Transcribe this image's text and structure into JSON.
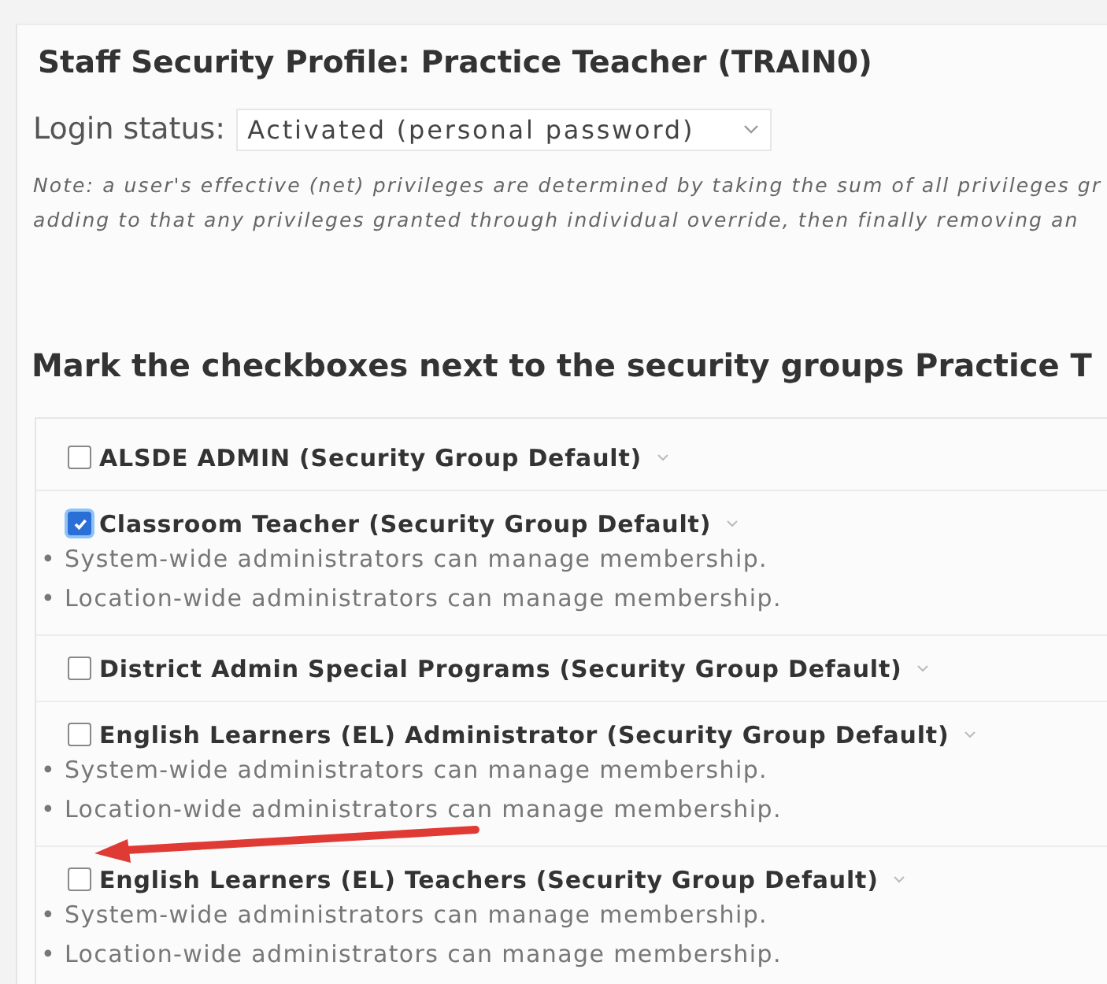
{
  "title": "Staff Security Profile: Practice Teacher (TRAIN0)",
  "login_status": {
    "label": "Login status:",
    "value": "Activated (personal password)"
  },
  "note": [
    "Note: a user's effective (net) privileges are determined by taking the sum of all privileges gr",
    "adding to that any privileges granted through individual override, then finally removing an"
  ],
  "groups_heading": "Mark the checkboxes next to the security groups Practice T",
  "groups": [
    {
      "label": "ALSDE ADMIN (Security Group Default)",
      "checked": false
    },
    {
      "label": "Classroom Teacher (Security Group Default)",
      "checked": true,
      "notes": [
        "• System-wide administrators can manage membership.",
        "• Location-wide administrators can manage membership."
      ]
    },
    {
      "label": "District Admin Special Programs (Security Group Default)",
      "checked": false
    },
    {
      "label": "English Learners (EL) Administrator (Security Group Default)",
      "checked": false,
      "notes": [
        "• System-wide administrators can manage membership.",
        "• Location-wide administrators can manage membership."
      ]
    },
    {
      "label": "English Learners (EL) Teachers (Security Group Default)",
      "checked": false,
      "notes": [
        "• System-wide administrators can manage membership.",
        "• Location-wide administrators can manage membership."
      ]
    }
  ]
}
